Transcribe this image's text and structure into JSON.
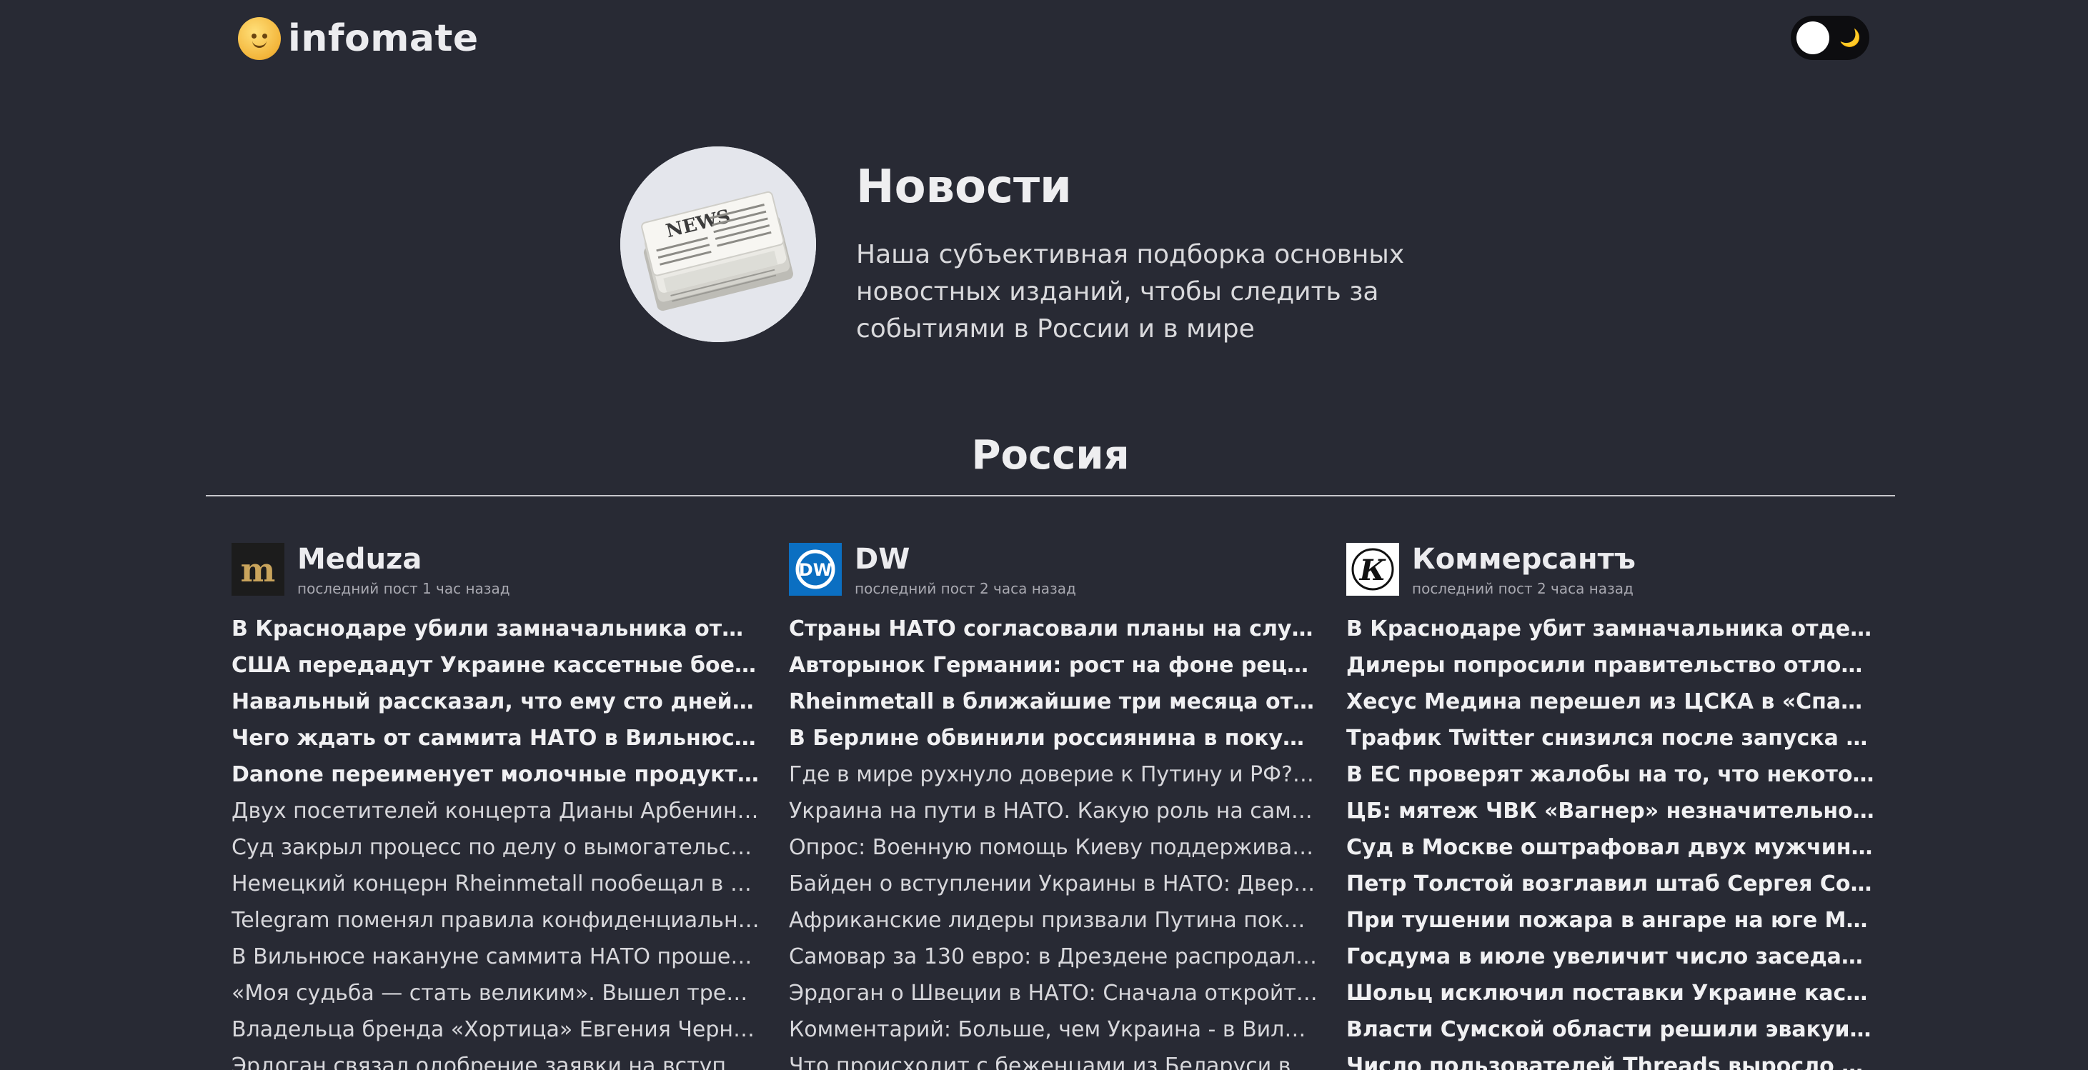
{
  "brand": {
    "name": "infomate"
  },
  "theme_toggle": {
    "moon_glyph": "🌙",
    "mode": "dark"
  },
  "hero": {
    "title": "Новости",
    "description": "Наша субъективная подборка основных новостных изданий, чтобы следить за событиями в России и в мире",
    "image_icon": "newspaper-icon"
  },
  "section": {
    "title": "Россия"
  },
  "sources": [
    {
      "name": "Meduza",
      "meta": "последний пост 1 час назад",
      "icon": "meduza-logo-icon",
      "items": [
        {
          "title": "В Краснодаре убили замначальника отдела по мобилизации",
          "fresh": true
        },
        {
          "title": "США передадут Украине кассетные боеприпасы",
          "fresh": true
        },
        {
          "title": "Навальный рассказал, что ему сто дней подряд",
          "fresh": true
        },
        {
          "title": "Чего ждать от саммита НАТО в Вильнюсе? Украина",
          "fresh": true
        },
        {
          "title": "Danone переименует молочные продукты «Активиа»",
          "fresh": true
        },
        {
          "title": "Двух посетителей концерта Дианы Арбениной оштрафовали",
          "fresh": false
        },
        {
          "title": "Суд закрыл процесс по делу о вымогательстве у главы",
          "fresh": false
        },
        {
          "title": "Немецкий концерн Rheinmetall пообещал в ближайшее время",
          "fresh": false
        },
        {
          "title": "Telegram поменял правила конфиденциальности и",
          "fresh": false
        },
        {
          "title": "В Вильнюсе накануне саммита НАТО прошел «самый",
          "fresh": false
        },
        {
          "title": "«Моя судьба — стать великим». Вышел трейлер фильма",
          "fresh": false
        },
        {
          "title": "Владельца бренда «Хортица» Евгения Черняка внесли",
          "fresh": false
        },
        {
          "title": "Эрдоган связал одобрение заявки на вступление",
          "fresh": false
        }
      ]
    },
    {
      "name": "DW",
      "meta": "последний пост 2 часа назад",
      "icon": "dw-logo-icon",
      "items": [
        {
          "title": "Страны НАТО согласовали планы на случай нападения",
          "fresh": true
        },
        {
          "title": "Авторынок Германии: рост на фоне рецессии, VW",
          "fresh": true
        },
        {
          "title": "Rheinmetall в ближайшие три месяца откроет танковый завод",
          "fresh": true
        },
        {
          "title": "В Берлине обвинили россиянина в покушении на",
          "fresh": true
        },
        {
          "title": "Где в мире рухнуло доверие к Путину и РФ? Итоги",
          "fresh": false
        },
        {
          "title": "Украина на пути в НАТО. Какую роль на саммите",
          "fresh": false
        },
        {
          "title": "Опрос: Военную помощь Киеву поддерживают почти",
          "fresh": false
        },
        {
          "title": "Байден о вступлении Украины в НАТО: Дверь открыта",
          "fresh": false
        },
        {
          "title": "Африканские лидеры призвали Путина показать",
          "fresh": false
        },
        {
          "title": "Самовар за 130 евро: в Дрездене распродали \"Мир",
          "fresh": false
        },
        {
          "title": "Эрдоган о Швеции в НАТО: Сначала откройте Турции",
          "fresh": false
        },
        {
          "title": "Комментарий: Больше, чем Украина - в Вильнюсе",
          "fresh": false
        },
        {
          "title": "Что происходит с беженцами из Беларуси в Германии",
          "fresh": false
        }
      ]
    },
    {
      "name": "Коммерсантъ",
      "meta": "последний пост 2 часа назад",
      "icon": "kommersant-logo-icon",
      "items": [
        {
          "title": "В Краснодаре убит замначальника отдела по мобилизации",
          "fresh": true
        },
        {
          "title": "Дилеры попросили правительство отложить инициативу",
          "fresh": true
        },
        {
          "title": "Хесус Медина перешел из ЦСКА в «Спартак»",
          "fresh": true
        },
        {
          "title": "Трафик Twitter снизился после запуска Threads",
          "fresh": true
        },
        {
          "title": "В ЕС проверят жалобы на то, что некоторые продукты",
          "fresh": true
        },
        {
          "title": "ЦБ: мятеж ЧВК «Вагнер» незначительно повлиял",
          "fresh": true
        },
        {
          "title": "Суд в Москве оштрафовал двух мужчин за украинский",
          "fresh": true
        },
        {
          "title": "Петр Толстой возглавил штаб Сергея Собянина на выборах",
          "fresh": true
        },
        {
          "title": "При тушении пожара в ангаре на юге Москвы пострадал",
          "fresh": true
        },
        {
          "title": "Госдума в июле увеличит число заседаний с трех до",
          "fresh": true
        },
        {
          "title": "Шольц исключил поставки Украине кассетных боеприпасов",
          "fresh": true
        },
        {
          "title": "Власти Сумской области решили эвакуировать жителей",
          "fresh": true
        },
        {
          "title": "Число пользователей Threads выросло до 100 млн",
          "fresh": true
        }
      ]
    }
  ]
}
